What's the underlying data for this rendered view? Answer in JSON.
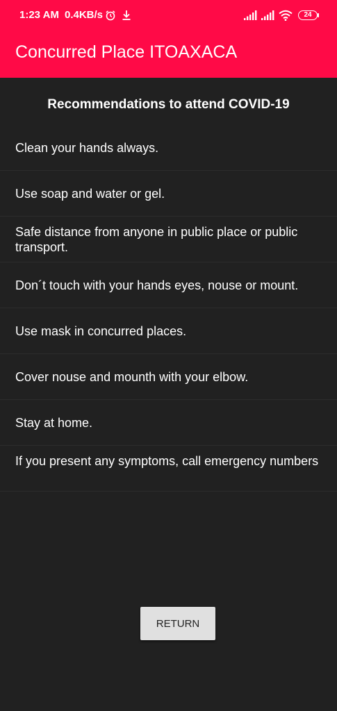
{
  "status_bar": {
    "time": "1:23 AM",
    "speed": "0.4KB/s",
    "battery": "24",
    "icons": [
      "alarm-icon",
      "download-icon",
      "signal-icon",
      "signal-icon",
      "wifi-icon",
      "battery-icon"
    ]
  },
  "app_bar": {
    "title": "Concurred Place ITOAXACA",
    "color": "#ff0a47"
  },
  "main": {
    "heading": "Recommendations to attend COVID-19",
    "items": [
      "Clean your hands always.",
      "Use soap and water or gel.",
      "Safe distance from anyone in public place or public transport.",
      "Don´t touch with your hands eyes, nouse or mount.",
      "Use mask in concurred places.",
      "Cover nouse and mounth with your elbow.",
      "Stay at home.",
      "If you present any symptoms, call emergency numbers"
    ]
  },
  "return_button": {
    "label": "RETURN"
  }
}
